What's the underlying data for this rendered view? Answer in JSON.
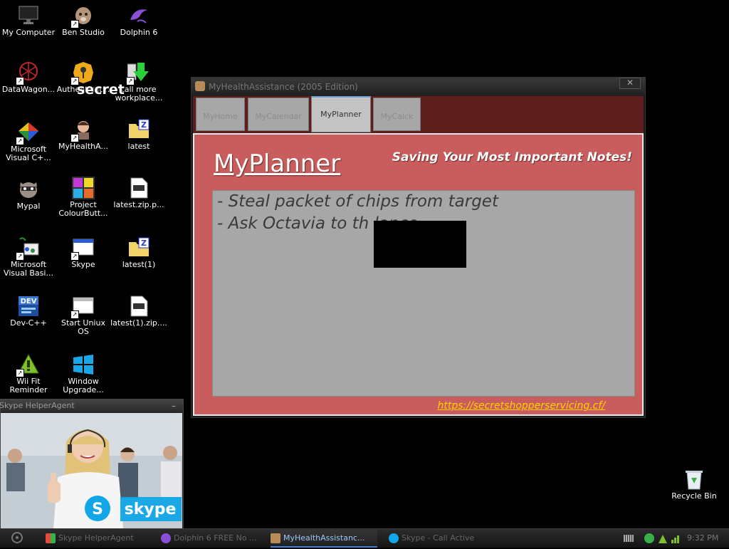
{
  "desktop": {
    "icons": [
      {
        "label": "My Computer"
      },
      {
        "label": "Ben Studio"
      },
      {
        "label": "Dolphin 6"
      },
      {
        "label": "DataWagon..."
      },
      {
        "label": "Authenticat..."
      },
      {
        "label": "tall more workplace..."
      },
      {
        "label": "Microsoft Visual C+..."
      },
      {
        "label": "MyHealthA..."
      },
      {
        "label": "latest"
      },
      {
        "label": "Mypal"
      },
      {
        "label": "Project ColourButt..."
      },
      {
        "label": "latest.zip.p..."
      },
      {
        "label": "Microsoft Visual Basi..."
      },
      {
        "label": "Skype"
      },
      {
        "label": "latest(1)"
      },
      {
        "label": "Dev-C++"
      },
      {
        "label": "Start Uniux OS"
      },
      {
        "label": "latest(1).zip...."
      },
      {
        "label": "Wii Fit Reminder"
      },
      {
        "label": "Window Upgrade..."
      }
    ],
    "secret_overlay": "secret",
    "recycle_bin": "Recycle Bin",
    "dev_icon_text": "DEV",
    "zip_letter": "Z"
  },
  "app_window": {
    "title": "MyHealthAssistance (2005 Edition)",
    "close_label": "✕",
    "tabs": [
      {
        "label": "MyHome",
        "active": false
      },
      {
        "label": "MyCalendar",
        "active": false
      },
      {
        "label": "MyPlanner",
        "active": true
      },
      {
        "label": "MyCalck",
        "active": false
      }
    ],
    "heading": "MyPlanner",
    "tagline": "Saving Your Most Important Notes!",
    "notes": [
      "- Steal packet of chips from target",
      "- Ask Octavia to th                lance"
    ],
    "link": "https://secretshopperservicing.cf/"
  },
  "helper_panel": {
    "title": "Skype HelperAgent",
    "minimize": "–",
    "skype_text": "skype"
  },
  "taskbar": {
    "tasks": [
      {
        "label": "Skype HelperAgent",
        "active": false
      },
      {
        "label": "Dolphin 6 FREE No ...",
        "active": false
      },
      {
        "label": "MyHealthAssistanc...",
        "active": true
      },
      {
        "label": "Skype - Call Active",
        "active": false
      }
    ],
    "clock": "9:32 PM"
  },
  "colors": {
    "content_bg": "#c95d5d",
    "tab_bar_bg": "#5e1e1e",
    "notes_bg": "#a7a7a7",
    "link": "#ffd000",
    "active_task": "#9ec6ff"
  }
}
